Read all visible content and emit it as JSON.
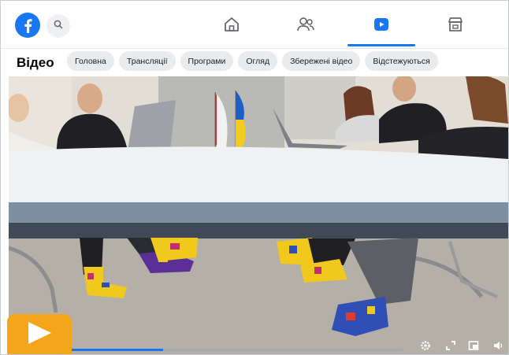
{
  "topnav": {
    "logo_icon": "facebook-logo",
    "search_icon": "search-icon",
    "tabs": [
      {
        "icon": "home-icon",
        "active": false
      },
      {
        "icon": "friends-icon",
        "active": false
      },
      {
        "icon": "video-icon",
        "active": true
      },
      {
        "icon": "marketplace-icon",
        "active": false
      }
    ]
  },
  "video_page": {
    "title": "Відео",
    "chips": [
      "Головна",
      "Трансляції",
      "Програми",
      "Огляд",
      "Збережені відео",
      "Відстежуються"
    ]
  },
  "player": {
    "progress": 0.29,
    "controls": [
      "settings-icon",
      "fullscreen-icon",
      "miniplayer-icon",
      "volume-icon"
    ],
    "play_icon": "play-icon"
  },
  "colors": {
    "brand": "#1877f2",
    "badge": "#f4a51a"
  }
}
